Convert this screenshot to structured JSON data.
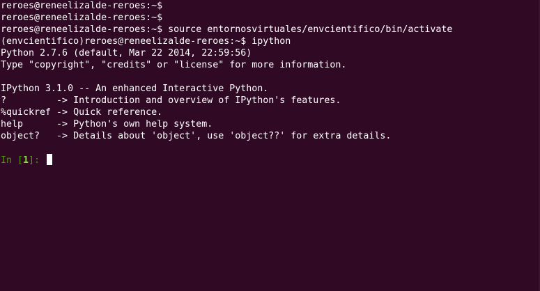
{
  "terminal": {
    "lines": [
      "reroes@reneelizalde-reroes:~$",
      "reroes@reneelizalde-reroes:~$",
      "reroes@reneelizalde-reroes:~$ source entornosvirtuales/envcientifico/bin/activate",
      "(envcientifico)reroes@reneelizalde-reroes:~$ ipython",
      "Python 2.7.6 (default, Mar 22 2014, 22:59:56)",
      "Type \"copyright\", \"credits\" or \"license\" for more information.",
      "",
      "IPython 3.1.0 -- An enhanced Interactive Python.",
      "?         -> Introduction and overview of IPython's features.",
      "%quickref -> Quick reference.",
      "help      -> Python's own help system.",
      "object?   -> Details about 'object', use 'object??' for extra details.",
      ""
    ],
    "input_prompt": {
      "prefix": "In [",
      "number": "1",
      "suffix": "]: "
    },
    "colors": {
      "background": "#300a24",
      "text": "#ffffff",
      "prompt": "#4e9a06",
      "prompt_number": "#8ae234"
    }
  }
}
